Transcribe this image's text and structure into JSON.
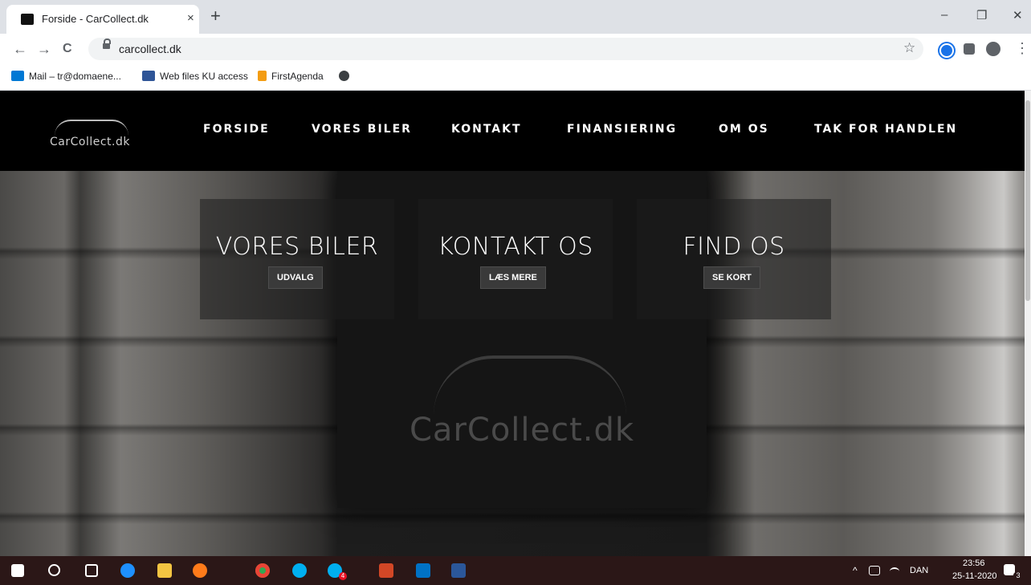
{
  "browser": {
    "tab_title": "Forside - CarCollect.dk",
    "tab_close": "×",
    "new_tab": "+",
    "win_min": "–",
    "win_restore": "❐",
    "win_close": "✕",
    "url": "carcollect.dk",
    "back": "←",
    "forward": "→",
    "reload": "C",
    "star": "☆",
    "menu": "⋮"
  },
  "bookmarks": [
    {
      "label": "Mail – tr@domaene...",
      "color": "#0078d4"
    },
    {
      "label": "Web files KU access",
      "color": "#2f5597"
    },
    {
      "label": "FirstAgenda",
      "color": "#f39c12"
    }
  ],
  "site": {
    "logo_text": "CarCollect.dk",
    "menu": [
      "FORSIDE",
      "VORES BILER",
      "KONTAKT",
      "FINANSIERING",
      "OM OS",
      "TAK FOR HANDLEN"
    ],
    "cards": [
      {
        "title": "VORES BILER",
        "button": "UDVALG"
      },
      {
        "title": "KONTAKT OS",
        "button": "LÆS MERE"
      },
      {
        "title": "FIND OS",
        "button": "SE KORT"
      }
    ],
    "sign_text": "CarCollect.dk"
  },
  "taskbar": {
    "language": "DAN",
    "time": "23:56",
    "date": "25-11-2020",
    "notification_count": "3",
    "skype_badge": "4"
  }
}
